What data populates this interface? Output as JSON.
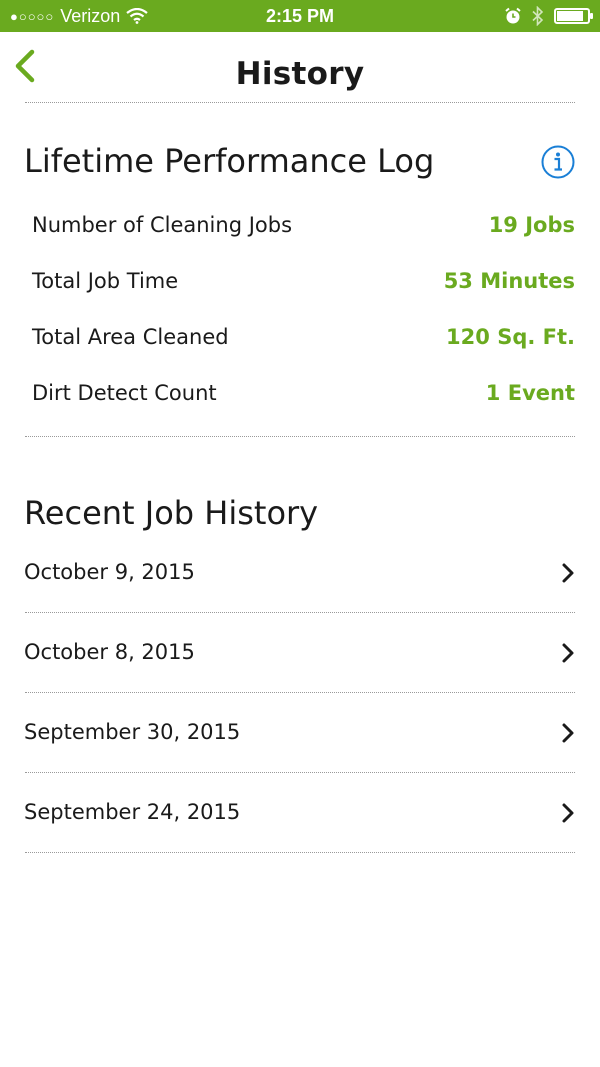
{
  "status_bar": {
    "signal": "●○○○○",
    "carrier": "Verizon",
    "time": "2:15 PM",
    "battery_level": 0.85
  },
  "nav": {
    "title": "History"
  },
  "lifetime": {
    "title": "Lifetime Performance Log",
    "stats": [
      {
        "label": "Number of Cleaning Jobs",
        "value": "19 Jobs"
      },
      {
        "label": "Total Job Time",
        "value": "53 Minutes"
      },
      {
        "label": "Total Area Cleaned",
        "value": "120 Sq. Ft."
      },
      {
        "label": "Dirt Detect Count",
        "value": "1 Event"
      }
    ]
  },
  "recent": {
    "title": "Recent Job History",
    "jobs": [
      {
        "date": "October 9, 2015"
      },
      {
        "date": "October 8, 2015"
      },
      {
        "date": "September 30, 2015"
      },
      {
        "date": "September 24, 2015"
      }
    ]
  },
  "colors": {
    "accent": "#6aaa1f",
    "info_blue": "#1a7fd6"
  },
  "icons": {
    "back": "chevron-left-icon",
    "info": "info-icon",
    "row": "chevron-right-icon"
  }
}
